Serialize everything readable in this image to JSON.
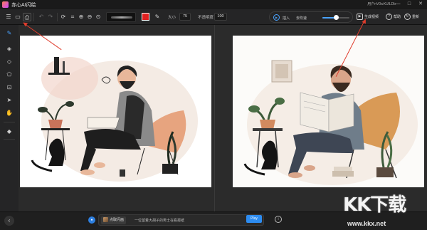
{
  "app": {
    "title": "赤心AI闪绘",
    "user_id": "用户nV0wXUlLDb"
  },
  "window_controls": {
    "minimize": "—",
    "maximize": "□",
    "close": "✕"
  },
  "toolbar": {
    "size_label": "大小",
    "size_value": "75",
    "opacity_label": "不透明度",
    "opacity_value": "100",
    "brush_color": "#e02020"
  },
  "right_toolbar": {
    "insert_label": "插入",
    "speed_label": "去吹速",
    "speed_level": 0.5,
    "generate_label": "生成视频",
    "help_label": "帮助",
    "reset_label": "重新"
  },
  "bottom": {
    "model_label": "点取闪画",
    "prompt_text": "一位留着大胡子的男士在看报纸",
    "play_label": "Play",
    "info_label": "i"
  },
  "watermark": {
    "logo_text": "KK下载",
    "url": "www.kkx.net"
  },
  "colors": {
    "accent": "#2d8cf0",
    "arrow": "#e03c2c",
    "background": "#1e1e1e"
  }
}
